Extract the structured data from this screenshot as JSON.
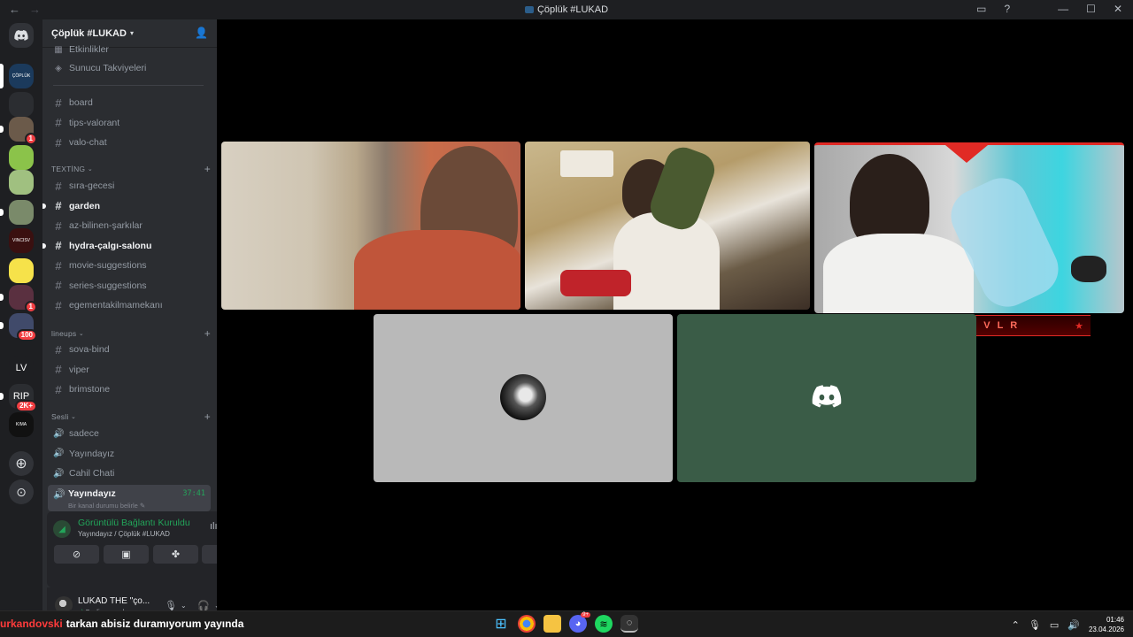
{
  "window": {
    "title": "Çöplük #LUKAD",
    "back": "←",
    "forward": "→"
  },
  "guilds": [
    {
      "label": "ÇÖPLÜK",
      "color": "#1b3a5c",
      "badge": ""
    },
    {
      "label": "",
      "color": "#2b2d31",
      "badge": ""
    },
    {
      "label": "",
      "color": "#6b5a4a",
      "badge": "1"
    },
    {
      "label": "",
      "color": "#8bc34a",
      "badge": ""
    },
    {
      "label": "",
      "color": "#a0c080",
      "badge": ""
    },
    {
      "label": "",
      "color": "#7a8a6a",
      "badge": ""
    },
    {
      "label": "VINCISV",
      "color": "#3a1010",
      "badge": ""
    },
    {
      "label": "",
      "color": "#f6e24a",
      "badge": ""
    },
    {
      "label": "",
      "color": "#5a3040",
      "badge": "1"
    },
    {
      "label": "",
      "color": "#404a6a",
      "badge": "100"
    },
    {
      "label": "LV",
      "color": "#1e1f22",
      "badge": ""
    },
    {
      "label": "RIP",
      "color": "#2b2d31",
      "badge": "2K+"
    },
    {
      "label": "KIMA",
      "color": "#111",
      "badge": ""
    }
  ],
  "sidebar": {
    "server_name": "Çöplük #LUKAD",
    "top_items": [
      {
        "label": "Etkinlikler"
      },
      {
        "label": "Sunucu Takviyeleri"
      }
    ],
    "channels_a": [
      {
        "label": "board",
        "bold": false
      },
      {
        "label": "tips-valorant",
        "bold": false
      },
      {
        "label": "valo-chat",
        "bold": false
      }
    ],
    "cat_texting": "TEXTİNG",
    "channels_b": [
      {
        "label": "sıra-gecesi",
        "bold": false
      },
      {
        "label": "garden",
        "bold": true
      },
      {
        "label": "az-bilinen-şarkılar",
        "bold": false
      },
      {
        "label": "hydra-çalgı-salonu",
        "bold": true
      },
      {
        "label": "movie-suggestions",
        "bold": false
      },
      {
        "label": "series-suggestions",
        "bold": false
      },
      {
        "label": "egementakilmamekanı",
        "bold": false
      }
    ],
    "cat_lineups": "lineups",
    "channels_c": [
      {
        "label": "sova-bind"
      },
      {
        "label": "viper"
      },
      {
        "label": "brimstone"
      }
    ],
    "cat_sesli": "Sesli",
    "voice_channels": [
      {
        "label": "sadece"
      },
      {
        "label": "Yayındayız"
      },
      {
        "label": "Cahil Chati"
      }
    ],
    "active_voice": {
      "label": "Yayındayız",
      "timer": "37:41",
      "status": "Bir kanal durumu belirle"
    }
  },
  "voice_panel": {
    "title": "Görüntülü Bağlantı Kuruldu",
    "subtitle": "Yayındayız / Çöplük #LUKAD"
  },
  "user_panel": {
    "name": "LUKAD THE \"ço...",
    "status": "Sesli aramada"
  },
  "stage": {
    "nameplate": "LUKADVLR"
  },
  "taskbar": {
    "ticker_user": "urkandovski",
    "ticker_message": "tarkan abisiz duramıyorum yayında",
    "time": "01:46",
    "date": "23.04.2026",
    "discord_badge": "9+"
  }
}
